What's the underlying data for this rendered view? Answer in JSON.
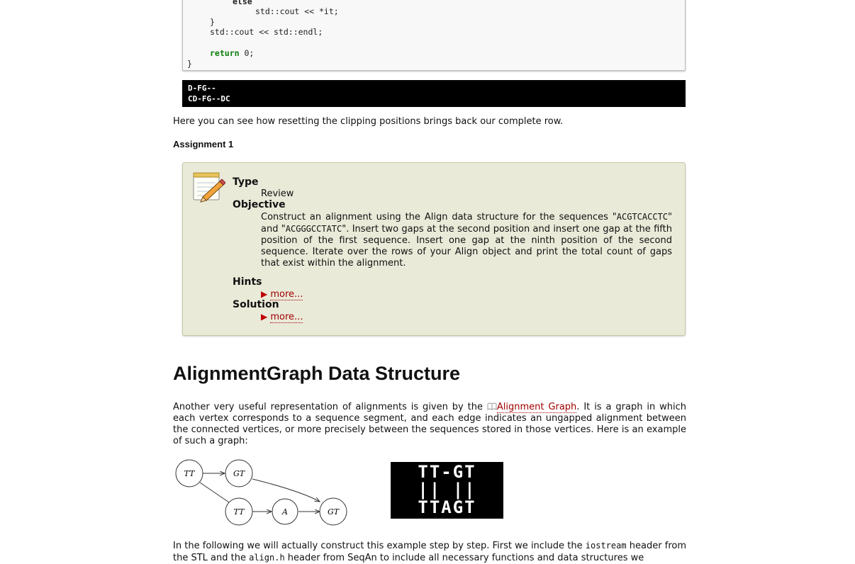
{
  "code": {
    "line_else": "else",
    "line_cout_it": "std::cout << *it;",
    "line_brace_inner": "}",
    "line_endl": "std::cout << std::endl;",
    "return_kw": "return",
    "return_val": "0;",
    "line_brace_outer": "}"
  },
  "console": {
    "line1": "D-FG--",
    "line2": "CD-FG--DC"
  },
  "intro_text": "Here you can see how resetting the clipping positions brings back our complete row.",
  "assignment": {
    "title": "Assignment 1",
    "type_label": "Type",
    "type_value": "Review",
    "objective_label": "Objective",
    "objective_p1": "Construct an alignment using the Align data structure for the sequences \"",
    "seq1": "ACGTCACCTC",
    "objective_p2": "\" and \"",
    "seq2": "ACGGGCCTATC",
    "objective_p3": "\". Insert two gaps at the second position and insert one gap at the fifth position of the first sequence. Insert one gap at the ninth position of the second sequence. Iterate over the rows of your Align object and print the total count of gaps that exist within the alignment.",
    "hints_label": "Hints",
    "hints_more": "more...",
    "solution_label": "Solution",
    "solution_more": "more..."
  },
  "section": {
    "heading": "AlignmentGraph Data Structure",
    "p1_before": "Another very useful representation of alignments is given by the ",
    "p1_link": "Alignment Graph",
    "p1_after": ". It is a graph in which each vertex corresponds to a sequence segment, and each edge indicates an ungapped alignment between the connected vertices, or more precisely between the sequences stored in those vertices. Here is an example of such a graph:"
  },
  "graph": {
    "nodes": [
      "TT",
      "GT",
      "TT",
      "A",
      "GT"
    ]
  },
  "alignment_image": {
    "row1": "TT-GT",
    "row2": "||  ||",
    "row3": "TTAGT"
  },
  "bottom": {
    "p_start": "In the following we will actually construct this example step by step. First we include the ",
    "code1": "iostream",
    "p_mid1": " header from the STL and the ",
    "code2": "align.h",
    "p_mid2": " header from SeqAn to include all necessary functions and data structures we"
  }
}
